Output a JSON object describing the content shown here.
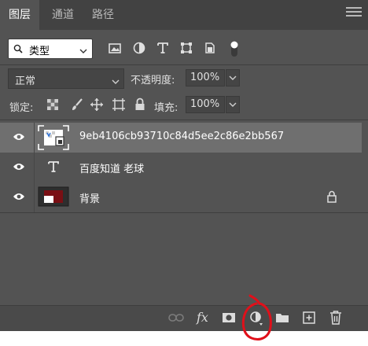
{
  "tabs": [
    {
      "label": "图层",
      "active": true
    },
    {
      "label": "通道",
      "active": false
    },
    {
      "label": "路径",
      "active": false
    }
  ],
  "filter": {
    "kind_label": "类型"
  },
  "blend_mode": "正常",
  "opacity": {
    "label": "不透明度:",
    "value": "100%"
  },
  "lock": {
    "label": "锁定:"
  },
  "fill": {
    "label": "填充:",
    "value": "100%"
  },
  "layers": [
    {
      "name": "9eb4106cb93710c84d5ee2c86e2bb567",
      "type": "smart-object",
      "visible": true,
      "selected": true
    },
    {
      "name": "百度知道  老球",
      "type": "text",
      "visible": true,
      "selected": false
    },
    {
      "name": "背景",
      "type": "background",
      "visible": true,
      "selected": false,
      "locked": true
    }
  ],
  "bottom_icons": [
    "link-icon",
    "fx-icon",
    "mask-icon",
    "adjustment-layer-icon",
    "group-folder-icon",
    "new-layer-icon",
    "trash-icon"
  ],
  "fx_label": "fx",
  "colors": {
    "panel": "#535353",
    "tabbar": "#424242",
    "selected_layer": "#6f6f6f",
    "annotation": "#e0101a",
    "thumb_red": "#7a0f14"
  }
}
